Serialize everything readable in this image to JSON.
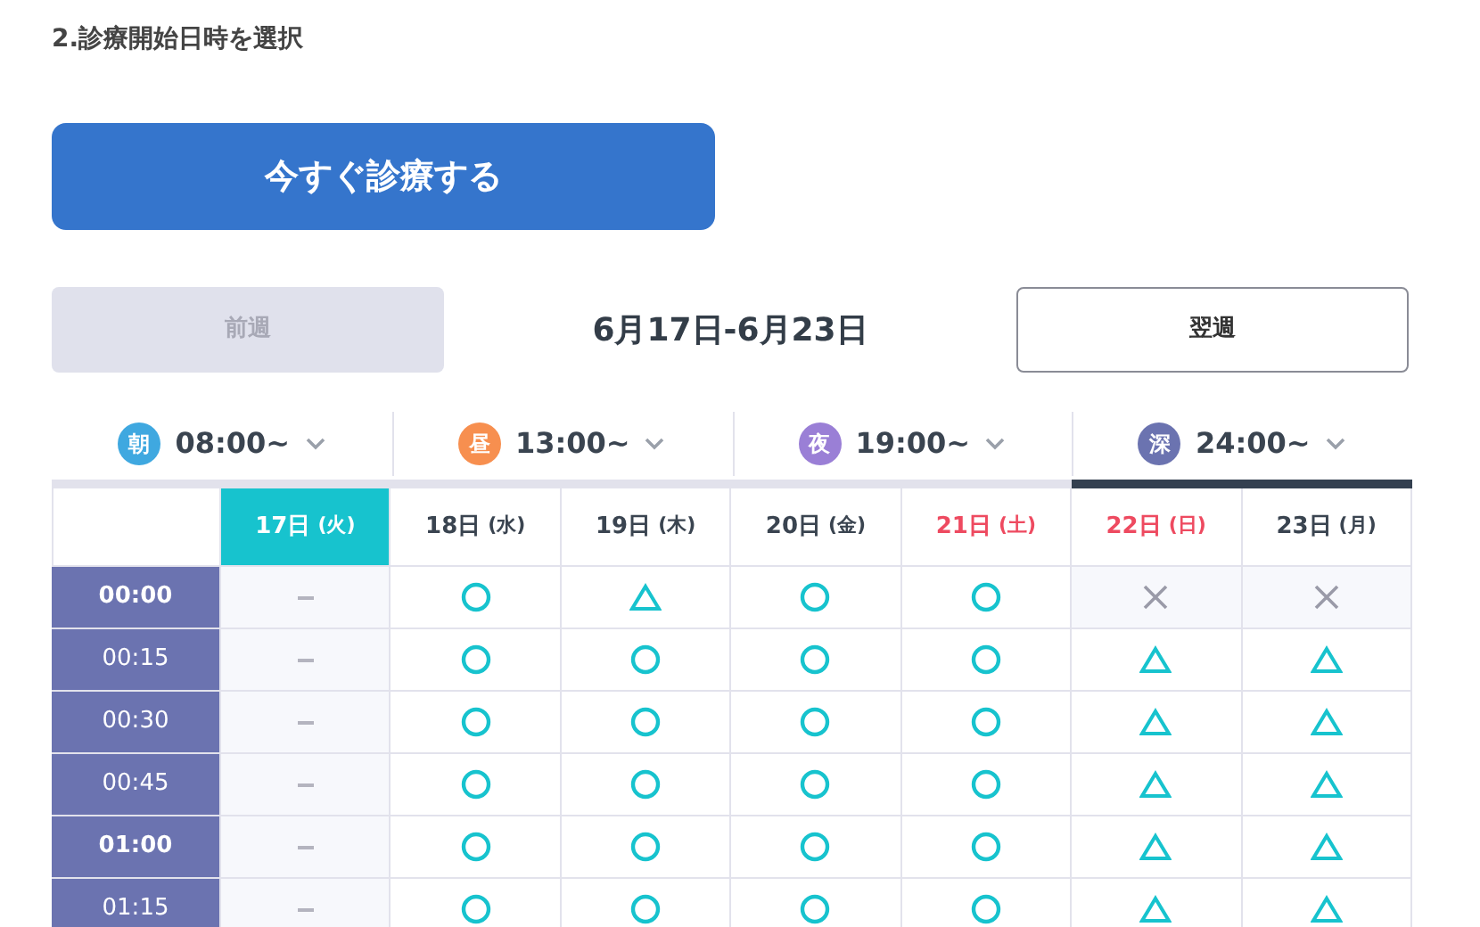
{
  "section_title": "2.診療開始日時を選択",
  "primary_button": "今すぐ診療する",
  "week_nav": {
    "prev": {
      "label": "前週",
      "disabled": true
    },
    "range": "6月17日-6月23日",
    "next": {
      "label": "翌週",
      "disabled": false
    }
  },
  "tabs": [
    {
      "badge": "朝",
      "color": "#3fa8e0",
      "label": "08:00~",
      "selected": false
    },
    {
      "badge": "昼",
      "color": "#f78f4f",
      "label": "13:00~",
      "selected": false
    },
    {
      "badge": "夜",
      "color": "#9a7fd6",
      "label": "19:00~",
      "selected": false
    },
    {
      "badge": "深",
      "color": "#6b73b0",
      "label": "24:00~",
      "selected": true
    }
  ],
  "days": [
    {
      "date": "17日",
      "weekday": "(火)",
      "kind": "weekday",
      "selected": true
    },
    {
      "date": "18日",
      "weekday": "(水)",
      "kind": "weekday",
      "selected": false
    },
    {
      "date": "19日",
      "weekday": "(木)",
      "kind": "weekday",
      "selected": false
    },
    {
      "date": "20日",
      "weekday": "(金)",
      "kind": "weekday",
      "selected": false
    },
    {
      "date": "21日",
      "weekday": "(土)",
      "kind": "holiday",
      "selected": false
    },
    {
      "date": "22日",
      "weekday": "(日)",
      "kind": "holiday",
      "selected": false
    },
    {
      "date": "23日",
      "weekday": "(月)",
      "kind": "weekday",
      "selected": false
    }
  ],
  "rows": [
    {
      "time": "00:00",
      "major": true,
      "slots": [
        {
          "kind": "none"
        },
        {
          "kind": "open"
        },
        {
          "kind": "few"
        },
        {
          "kind": "open"
        },
        {
          "kind": "open"
        },
        {
          "kind": "full"
        },
        {
          "kind": "full"
        }
      ]
    },
    {
      "time": "00:15",
      "major": false,
      "slots": [
        {
          "kind": "none"
        },
        {
          "kind": "open"
        },
        {
          "kind": "open"
        },
        {
          "kind": "open"
        },
        {
          "kind": "open"
        },
        {
          "kind": "few"
        },
        {
          "kind": "few"
        }
      ]
    },
    {
      "time": "00:30",
      "major": false,
      "slots": [
        {
          "kind": "none"
        },
        {
          "kind": "open"
        },
        {
          "kind": "open"
        },
        {
          "kind": "open"
        },
        {
          "kind": "open"
        },
        {
          "kind": "few"
        },
        {
          "kind": "few"
        }
      ]
    },
    {
      "time": "00:45",
      "major": false,
      "slots": [
        {
          "kind": "none"
        },
        {
          "kind": "open"
        },
        {
          "kind": "open"
        },
        {
          "kind": "open"
        },
        {
          "kind": "open"
        },
        {
          "kind": "few"
        },
        {
          "kind": "few"
        }
      ]
    },
    {
      "time": "01:00",
      "major": true,
      "slots": [
        {
          "kind": "none"
        },
        {
          "kind": "open"
        },
        {
          "kind": "open"
        },
        {
          "kind": "open"
        },
        {
          "kind": "open"
        },
        {
          "kind": "few"
        },
        {
          "kind": "few"
        }
      ]
    },
    {
      "time": "01:15",
      "major": false,
      "slots": [
        {
          "kind": "none"
        },
        {
          "kind": "open"
        },
        {
          "kind": "open"
        },
        {
          "kind": "open"
        },
        {
          "kind": "open"
        },
        {
          "kind": "few"
        },
        {
          "kind": "few"
        }
      ]
    }
  ]
}
